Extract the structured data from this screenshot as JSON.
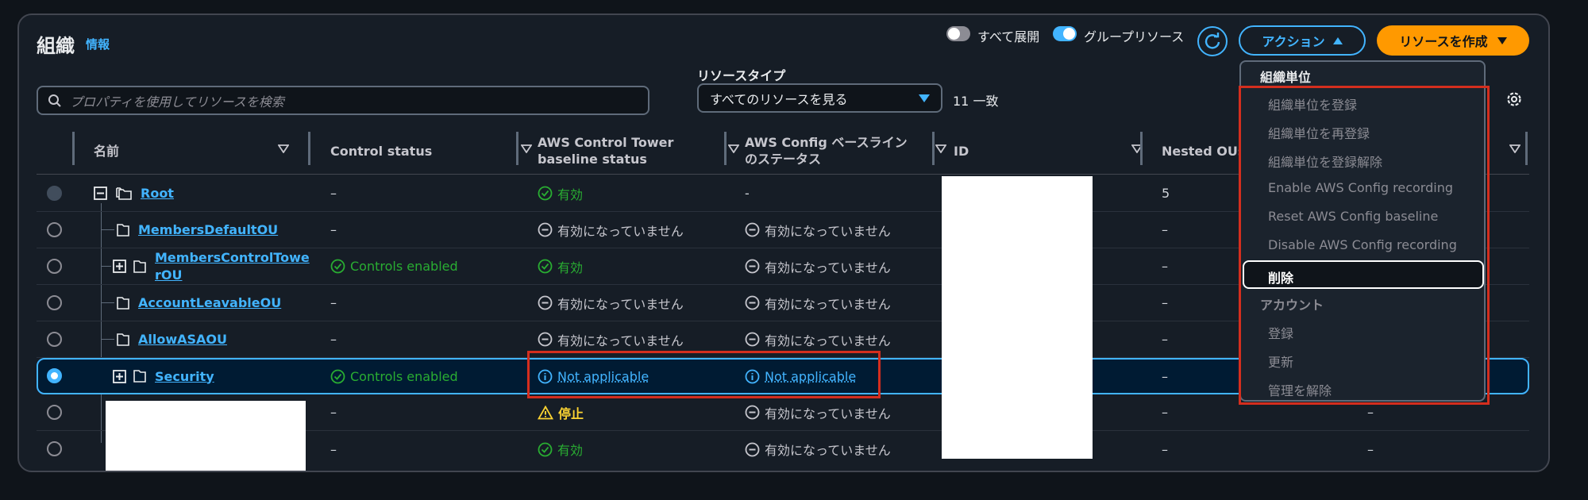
{
  "header": {
    "title": "組織",
    "info_link": "情報",
    "expand_all_label": "すべて展開",
    "group_resources_label": "グループリソース",
    "actions_button": "アクション",
    "create_button": "リソースを作成"
  },
  "toggles": {
    "expand_all": false,
    "group_resources": true
  },
  "search": {
    "placeholder": "プロパティを使用してリソースを検索",
    "value": ""
  },
  "resource_type": {
    "label": "リソースタイプ",
    "selected": "すべてのリソースを見る"
  },
  "match_count": "11 一致",
  "columns": {
    "name": "名前",
    "control_status": "Control status",
    "ct_baseline_line1": "AWS Control Tower",
    "ct_baseline_line2": "baseline status",
    "config_baseline_line1": "AWS Config ベースライン",
    "config_baseline_line2": "のステータス",
    "id": "ID",
    "nested_ous": "Nested OUs"
  },
  "rows": [
    {
      "name": "Root",
      "control": "–",
      "ct_status": "有効",
      "config_status": "-",
      "nested": "5",
      "extra": ""
    },
    {
      "name": "MembersDefaultOU",
      "control": "–",
      "ct_status": "有効になっていません",
      "config_status": "有効になっていません",
      "nested": "–",
      "extra": ""
    },
    {
      "name_line1": "MembersControlTowe",
      "name_line2": "rOU",
      "control": "Controls enabled",
      "ct_status": "有効",
      "config_status": "有効になっていません",
      "nested": "–",
      "extra": ""
    },
    {
      "name": "AccountLeavableOU",
      "control": "–",
      "ct_status": "有効になっていません",
      "config_status": "有効になっていません",
      "nested": "–",
      "extra": ""
    },
    {
      "name": "AllowASAOU",
      "control": "–",
      "ct_status": "有効になっていません",
      "config_status": "有効になっていません",
      "nested": "–",
      "extra": ""
    },
    {
      "name": "Security",
      "control": "Controls enabled",
      "ct_status": "Not applicable",
      "config_status": "Not applicable",
      "nested": "–",
      "extra": ""
    },
    {
      "name": "",
      "control": "–",
      "ct_status": "停止",
      "config_status": "有効になっていません",
      "nested": "–",
      "extra": "–"
    },
    {
      "name": "",
      "control": "–",
      "ct_status": "有効",
      "config_status": "有効になっていません",
      "nested": "–",
      "extra": "–"
    }
  ],
  "actions_menu": {
    "ou_group": "組織単位",
    "ou_items": [
      "組織単位を登録",
      "組織単位を再登録",
      "組織単位を登録解除",
      "Enable AWS Config recording",
      "Reset AWS Config baseline",
      "Disable AWS Config recording"
    ],
    "delete": "削除",
    "account_group": "アカウント",
    "account_items": [
      "登録",
      "更新",
      "管理を解除"
    ]
  },
  "colors": {
    "accent": "#42b4ff",
    "primary_button": "#ff9900",
    "success": "#29ad32",
    "warning": "#fbd332",
    "highlight": "#d42e1e"
  }
}
